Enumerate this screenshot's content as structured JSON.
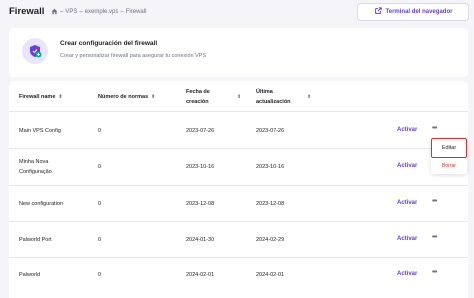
{
  "header": {
    "title": "Firewall",
    "breadcrumb": [
      "VPS",
      "exemple.vps",
      "Firewall"
    ],
    "terminal_button": "Terminal del navegador"
  },
  "card": {
    "title": "Crear configuración del firewall",
    "subtitle": "Crear y personalizar firewall para asegurar tu conexión VPS"
  },
  "table": {
    "headers": {
      "name": "Firewall name",
      "rules": "Número de normas",
      "created": [
        "Fecha de",
        "creación"
      ],
      "updated": [
        "Última",
        "actualización"
      ]
    },
    "action_label": "Activar",
    "rows": [
      {
        "name": [
          "Main VPS Config"
        ],
        "rules": "0",
        "created": "2023-07-26",
        "updated": "2023-07-26"
      },
      {
        "name": [
          "Minha Nova",
          "Configuração"
        ],
        "rules": "0",
        "created": "2023-10-16",
        "updated": "2023-10-16"
      },
      {
        "name": [
          "New configuration"
        ],
        "rules": "0",
        "created": "2023-12-08",
        "updated": "2023-12-08"
      },
      {
        "name": [
          "Palworld Port"
        ],
        "rules": "0",
        "created": "2024-01-30",
        "updated": "2024-02-29"
      },
      {
        "name": [
          "Palworld"
        ],
        "rules": "0",
        "created": "2024-02-01",
        "updated": "2024-02-01"
      }
    ]
  },
  "menu": {
    "edit": "Editar",
    "delete": "Borrar"
  }
}
